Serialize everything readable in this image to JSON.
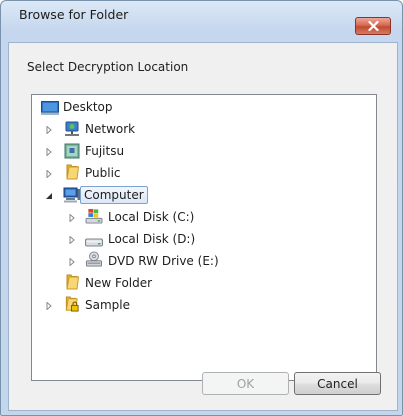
{
  "window": {
    "title": "Browse for Folder"
  },
  "dialog": {
    "instruction": "Select Decryption Location"
  },
  "tree": {
    "items": [
      {
        "label": "Desktop",
        "icon": "desktop-icon",
        "level": 0,
        "expander": "none"
      },
      {
        "label": "Network",
        "icon": "network-icon",
        "level": 1,
        "expander": "collapsed"
      },
      {
        "label": "Fujitsu",
        "icon": "user-folder-icon",
        "level": 1,
        "expander": "collapsed"
      },
      {
        "label": "Public",
        "icon": "folder-icon",
        "level": 1,
        "expander": "collapsed"
      },
      {
        "label": "Computer",
        "icon": "computer-icon",
        "level": 1,
        "expander": "expanded",
        "selected": true
      },
      {
        "label": "Local Disk (C:)",
        "icon": "windows-drive-icon",
        "level": 2,
        "expander": "collapsed"
      },
      {
        "label": "Local Disk (D:)",
        "icon": "hard-drive-icon",
        "level": 2,
        "expander": "collapsed"
      },
      {
        "label": "DVD RW Drive (E:)",
        "icon": "dvd-drive-icon",
        "level": 2,
        "expander": "collapsed"
      },
      {
        "label": "New Folder",
        "icon": "folder-icon",
        "level": 1,
        "expander": "none"
      },
      {
        "label": "Sample",
        "icon": "locked-folder-icon",
        "level": 1,
        "expander": "collapsed"
      }
    ]
  },
  "buttons": {
    "ok_label": "OK",
    "cancel_label": "Cancel",
    "ok_enabled": false
  },
  "colors": {
    "selection_border": "#7da2ce",
    "close_button": "#c9553b",
    "frame": "#c5d7ee"
  }
}
